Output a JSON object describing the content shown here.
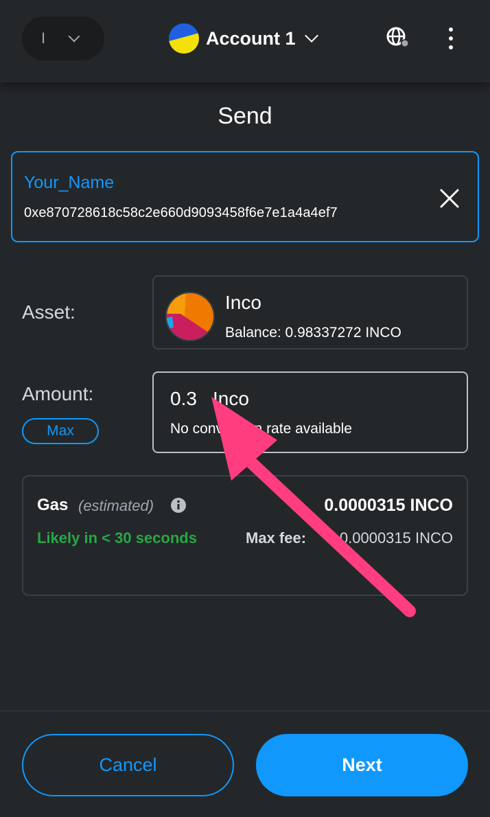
{
  "header": {
    "network_initial": "I",
    "account_name": "Account 1"
  },
  "page": {
    "title": "Send"
  },
  "recipient": {
    "name": "Your_Name",
    "address": "0xe870728618c58c2e660d9093458f6e7e1a4a4ef7"
  },
  "asset": {
    "label": "Asset:",
    "name": "Inco",
    "balance": "Balance:  0.98337272 INCO"
  },
  "amount": {
    "label": "Amount:",
    "max_label": "Max",
    "value": "0.3",
    "unit": "Inco",
    "conversion": "No conversion rate available"
  },
  "gas": {
    "title": "Gas",
    "estimated": "(estimated)",
    "amount": "0.0000315 INCO",
    "likely": "Likely in < 30 seconds",
    "max_fee_label": "Max fee:",
    "max_fee_value": "0.0000315 INCO"
  },
  "footer": {
    "cancel_label": "Cancel",
    "next_label": "Next"
  },
  "colors": {
    "accent": "#1098fc",
    "background": "#24272a",
    "success": "#28a745",
    "annotation_arrow": "#ff3d7f"
  },
  "icons": {
    "network_chevron": "chevron-down-icon",
    "account_avatar": "account-avatar-icon",
    "globe": "globe-icon",
    "menu": "kebab-menu-icon",
    "clear": "close-icon",
    "token": "inco-token-icon",
    "info": "info-icon",
    "annotation": "arrow-annotation-icon"
  }
}
